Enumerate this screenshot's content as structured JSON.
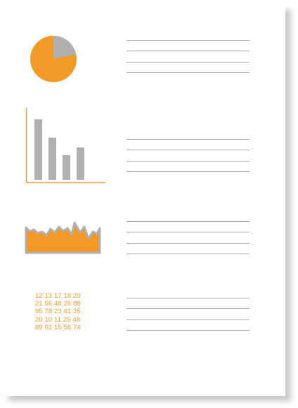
{
  "colors": {
    "accent": "#f39a26",
    "muted": "#b0b0b2",
    "line": "#a9a9a9"
  },
  "icons": {
    "pie": "pie-chart-icon",
    "bar": "bar-chart-icon",
    "area": "area-chart-icon"
  },
  "pie_chart": {
    "slices": [
      0.79,
      0.21
    ]
  },
  "bar_chart": {
    "values": [
      86,
      60,
      35,
      46
    ],
    "ylim": [
      0,
      100
    ]
  },
  "table": {
    "rows": [
      "12 13 17 18 20",
      "21 56 48 26 88",
      "95 78 23 41 35",
      "20 10 11 25 48",
      "89 02 15 56 74"
    ]
  }
}
